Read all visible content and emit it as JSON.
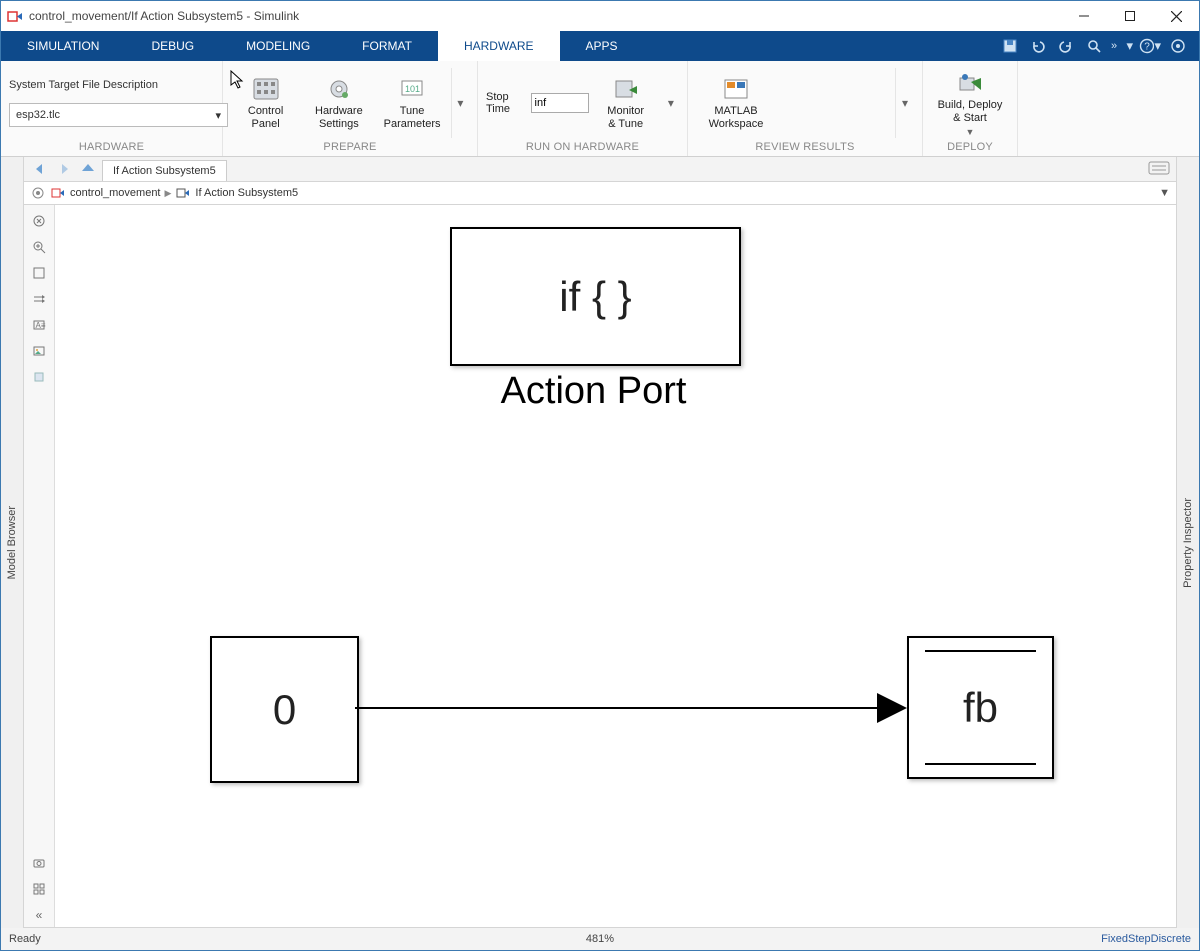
{
  "window": {
    "title": "control_movement/If Action Subsystem5 - Simulink"
  },
  "tabs": {
    "items": [
      {
        "label": "SIMULATION"
      },
      {
        "label": "DEBUG"
      },
      {
        "label": "MODELING"
      },
      {
        "label": "FORMAT"
      },
      {
        "label": "HARDWARE"
      },
      {
        "label": "APPS"
      }
    ],
    "active_index": 4
  },
  "ribbon": {
    "hardware": {
      "field_label": "System Target File Description",
      "field_value": "esp32.tlc",
      "group_label": "HARDWARE"
    },
    "prepare": {
      "control_panel": "Control\nPanel",
      "hardware_settings": "Hardware\nSettings",
      "tune_parameters": "Tune\nParameters",
      "group_label": "PREPARE"
    },
    "run": {
      "stop_time_label": "Stop Time",
      "stop_time_value": "inf",
      "monitor_tune": "Monitor\n& Tune",
      "group_label": "RUN ON HARDWARE"
    },
    "review": {
      "matlab_workspace": "MATLAB\nWorkspace",
      "group_label": "REVIEW RESULTS"
    },
    "deploy": {
      "build_deploy_start": "Build, Deploy\n& Start",
      "group_label": "DEPLOY"
    }
  },
  "side_panels": {
    "left": "Model Browser",
    "right": "Property Inspector"
  },
  "doc_tab": {
    "label": "If Action Subsystem5"
  },
  "breadcrumb": {
    "items": [
      "control_movement",
      "If Action Subsystem5"
    ]
  },
  "blocks": {
    "action_port": {
      "text": "if { }",
      "label": "Action Port"
    },
    "constant": {
      "value": "0"
    },
    "outport": {
      "label": "fb"
    }
  },
  "status": {
    "left": "Ready",
    "center": "481%",
    "right": "FixedStepDiscrete"
  }
}
